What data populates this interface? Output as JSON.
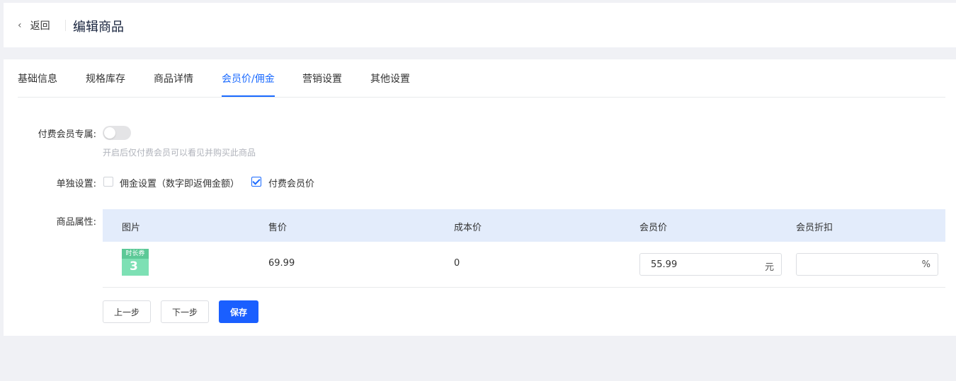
{
  "header": {
    "back_label": "返回",
    "title": "编辑商品"
  },
  "tabs": [
    {
      "label": "基础信息"
    },
    {
      "label": "规格库存"
    },
    {
      "label": "商品详情"
    },
    {
      "label": "会员价/佣金",
      "active": true
    },
    {
      "label": "营销设置"
    },
    {
      "label": "其他设置"
    }
  ],
  "form": {
    "paid_member": {
      "label": "付费会员专属:",
      "enabled": false,
      "hint": "开启后仅付费会员可以看见并购买此商品"
    },
    "separate": {
      "label": "单独设置:",
      "options": [
        {
          "label": "佣金设置（数字即返佣金额）",
          "checked": false
        },
        {
          "label": "付费会员价",
          "checked": true
        }
      ]
    },
    "attrs": {
      "label": "商品属性:"
    }
  },
  "table": {
    "headers": [
      "图片",
      "售价",
      "成本价",
      "会员价",
      "会员折扣"
    ],
    "rows": [
      {
        "image": {
          "top_text": "时长券",
          "big_text": "3"
        },
        "price": "69.99",
        "cost": "0",
        "member_price": "55.99",
        "member_price_unit": "元",
        "discount": "",
        "discount_unit": "%"
      }
    ]
  },
  "buttons": {
    "prev": "上一步",
    "next": "下一步",
    "save": "保存"
  },
  "colors": {
    "accent": "#1a6aff",
    "primary_button": "#1a5fff",
    "table_header": "#e3ecfb"
  }
}
